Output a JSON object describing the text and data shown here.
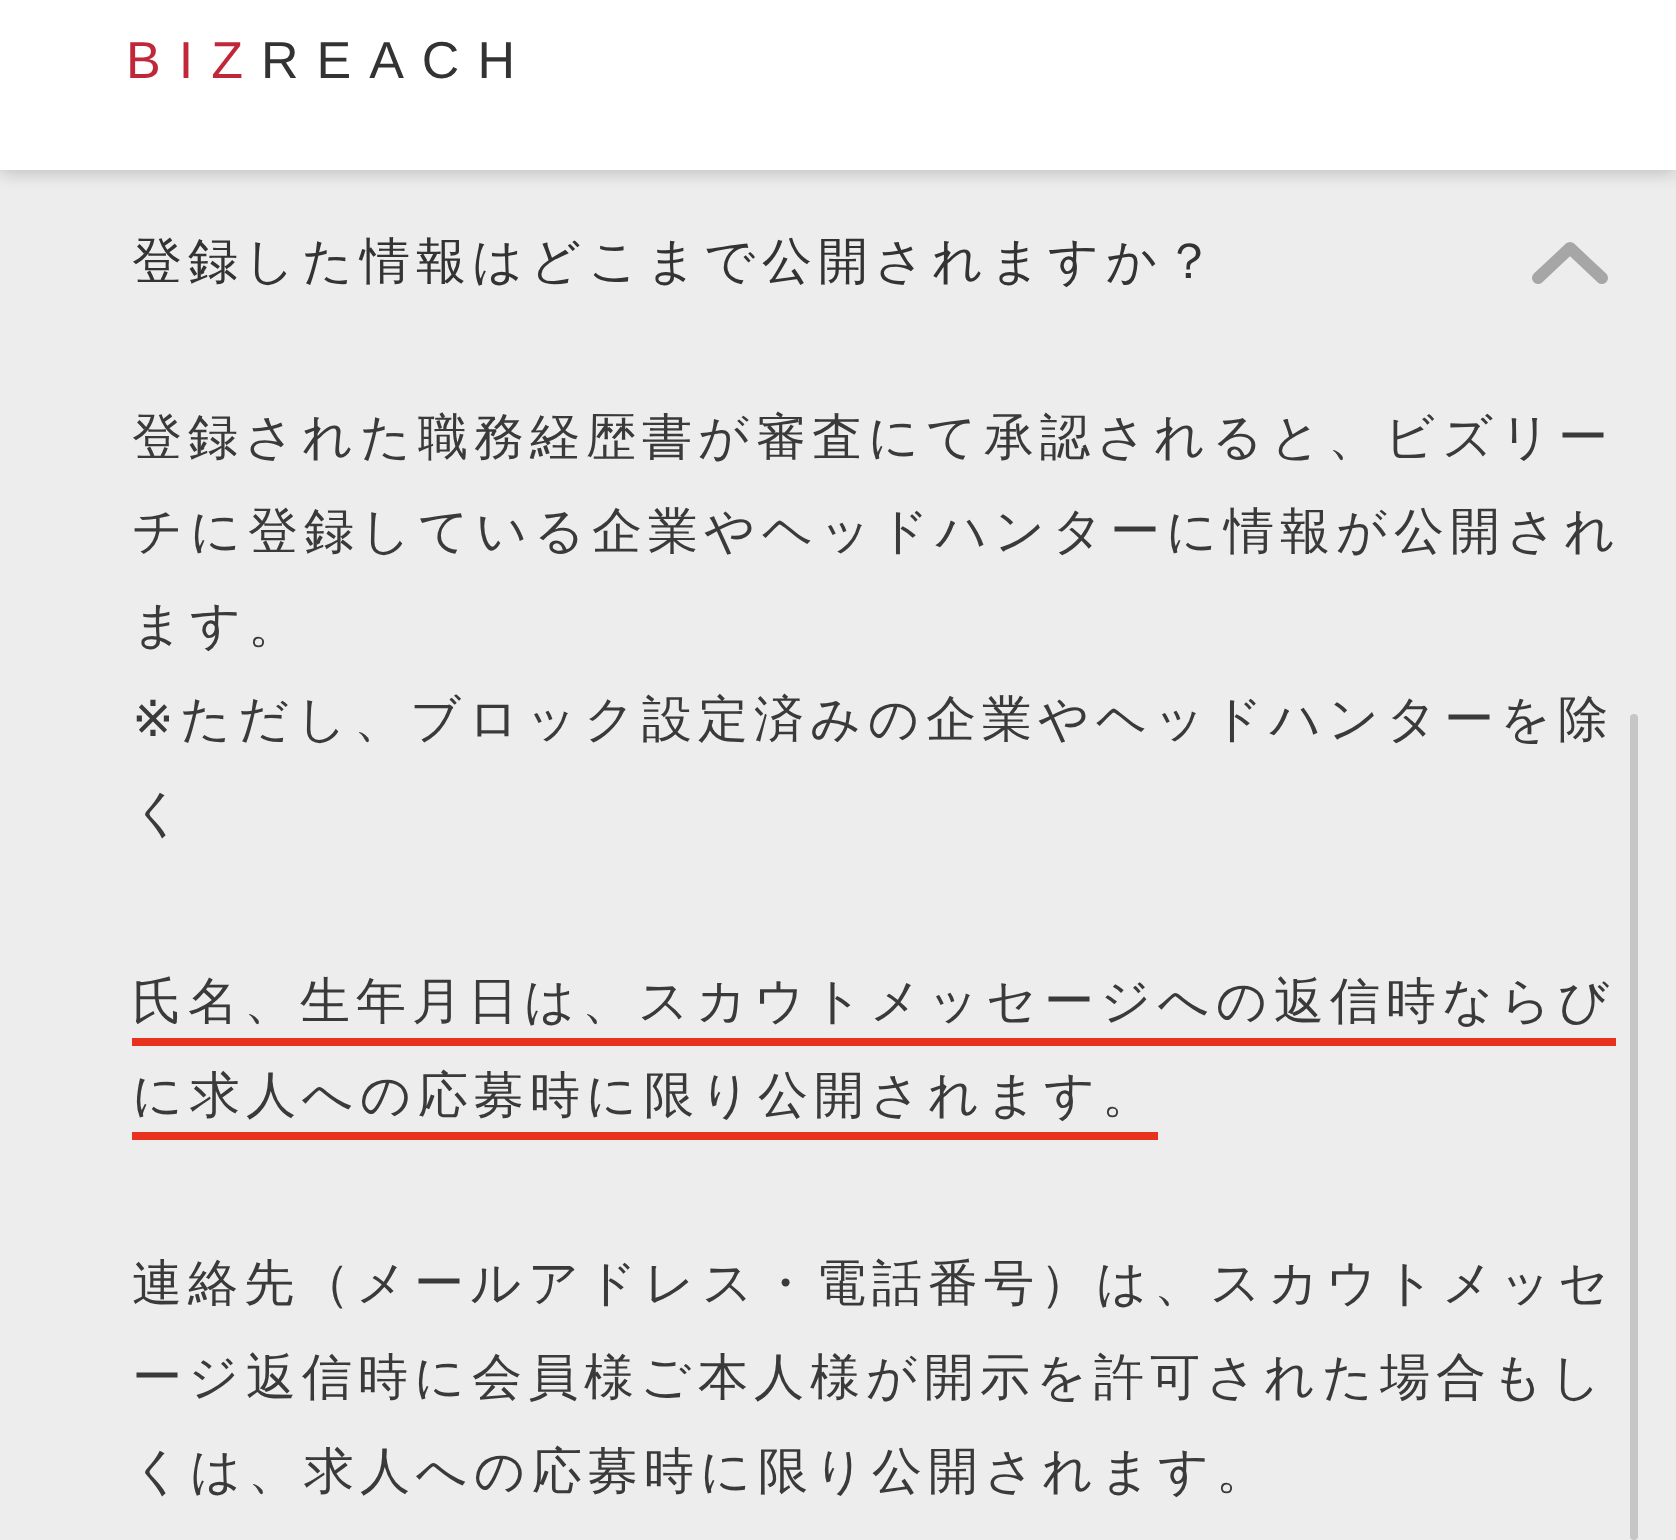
{
  "header": {
    "logo": [
      {
        "text": "BIZ",
        "color": "#c0283a"
      },
      {
        "text": "REACH",
        "color": "#333333"
      }
    ]
  },
  "faq": {
    "question": "登録した情報はどこまで公開されますか？",
    "expanded": true,
    "answer": [
      {
        "sentences": [
          {
            "text": "登録された職務経歴書が審査にて承認されると、ビズリーチに登録している企業やヘッドハンターに情報が公開されます。",
            "underlined": false
          },
          {
            "text": "※ただし、ブロック設定済みの企業やヘッドハンターを除く",
            "underlined": false
          }
        ]
      },
      {
        "sentences": [
          {
            "text": "氏名、生年月日は、スカウトメッセージへの返信時ならびに求人への応募時に限り公開されます。",
            "underlined": true
          }
        ]
      },
      {
        "sentences": [
          {
            "text": "連絡先（メールアドレス・電話番号）は、スカウトメッセージ返信時に会員様ご本人様が開示を許可された場合もしくは、求人への応募時に限り公開されます。",
            "underlined": false
          }
        ]
      }
    ]
  }
}
